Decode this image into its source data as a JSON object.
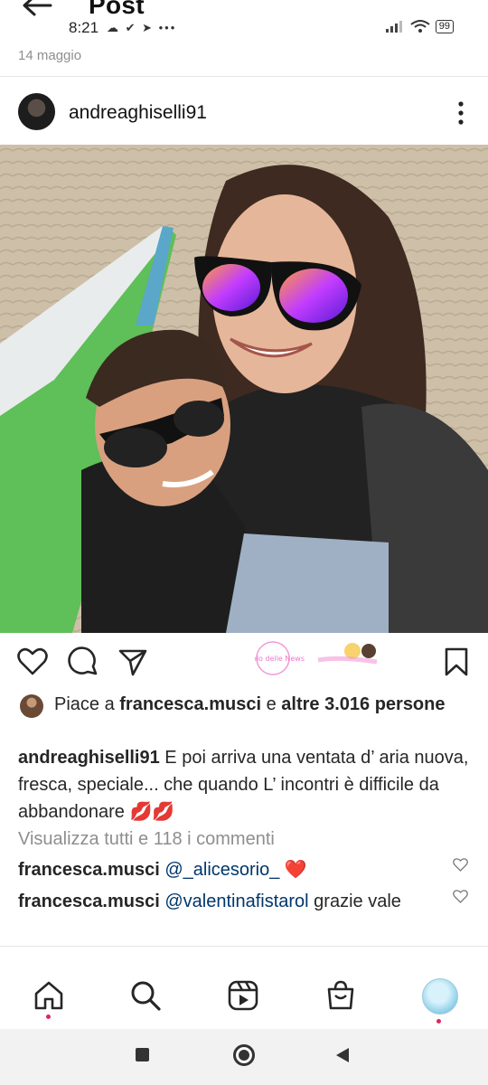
{
  "header": {
    "back_icon": "arrow-left-icon",
    "title": "Post",
    "status_time": "8:21",
    "status_icons": "☁ ✔ ➤ •••",
    "battery": "99"
  },
  "post": {
    "date": "14 maggio",
    "username": "andreaghiselli91",
    "likes_prefix": "Piace a ",
    "likes_user": "francesca.musci",
    "likes_mid": " e ",
    "likes_count": "altre 3.016 persone",
    "caption_user": "andreaghiselli91",
    "caption_text": " E poi arriva una ventata d’ aria nuova, fresca, speciale... che quando L’ incontri  è difficile da abbandonare 💋💋",
    "view_all": "Visualizza tutti e 118 i commenti",
    "comments": [
      {
        "user": "francesca.musci",
        "mention": "@_alicesorio_",
        "text": " ❤️"
      },
      {
        "user": "francesca.musci",
        "mention": "@valentinafistarol",
        "text": " grazie vale"
      }
    ]
  },
  "watermark": {
    "text": "Vicolo delle News"
  },
  "colors": {
    "accent_link": "#00376b",
    "muted": "#8e8e8e",
    "notification_dot": "#e0245e"
  },
  "icons": [
    "heart-icon",
    "comment-icon",
    "share-icon",
    "bookmark-icon",
    "home-icon",
    "search-icon",
    "reels-icon",
    "shop-icon",
    "profile-avatar",
    "stop-icon",
    "home-circle-icon",
    "back-triangle-icon"
  ]
}
